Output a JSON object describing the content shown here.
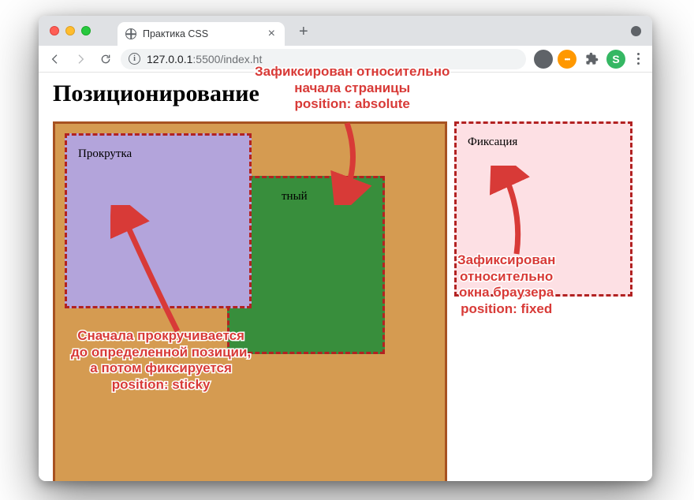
{
  "browser": {
    "tab_title": "Практика CSS",
    "new_tab_symbol": "+",
    "tab_close_symbol": "×",
    "url_host": "127.0.0.1",
    "url_port_path": ":5500/index.ht",
    "info_symbol": "i",
    "ext_orange_label": "•••",
    "ext_s_label": "S",
    "kebab_symbol": "⋮"
  },
  "page": {
    "heading": "Позиционирование",
    "purple_label": "Прокрутка",
    "green_label": "тный",
    "pink_label": "Фиксация"
  },
  "annotations": {
    "absolute": "Зафиксирован относительно\nначала страницы\nposition: absolute",
    "sticky": "Сначала прокручивается\nдо определенной позиции,\nа потом фиксируется\nposition: sticky",
    "fixed": "Зафиксирован\nотносительно\nокна браузера\nposition: fixed"
  }
}
